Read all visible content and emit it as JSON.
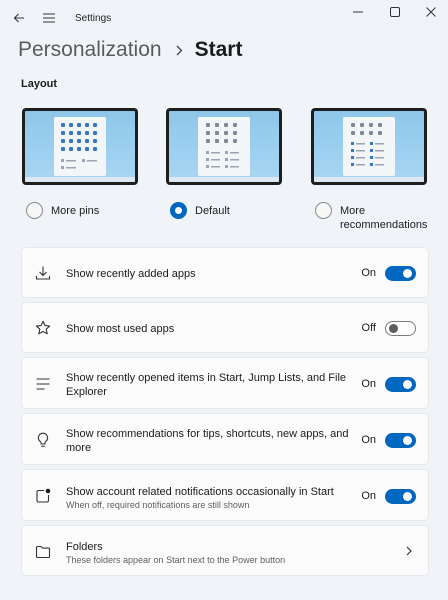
{
  "window": {
    "title": "Settings",
    "back_icon": "back-arrow-icon",
    "menu_icon": "hamburger-menu-icon",
    "controls": [
      "minimize-icon",
      "maximize-icon",
      "close-icon"
    ]
  },
  "breadcrumb": {
    "parent": "Personalization",
    "separator_icon": "chevron-right-icon",
    "current": "Start"
  },
  "layout": {
    "heading": "Layout",
    "options": [
      {
        "label": "More pins",
        "selected": false
      },
      {
        "label": "Default",
        "selected": true
      },
      {
        "label": "More recommendations",
        "selected": false
      }
    ]
  },
  "settings": [
    {
      "icon": "download-icon",
      "label": "Show recently added apps",
      "state": "On",
      "toggle_on": true
    },
    {
      "icon": "star-icon",
      "label": "Show most used apps",
      "state": "Off",
      "toggle_on": false
    },
    {
      "icon": "list-lines-icon",
      "label": "Show recently opened items in Start, Jump Lists, and File Explorer",
      "state": "On",
      "toggle_on": true
    },
    {
      "icon": "lightbulb-icon",
      "label": "Show recommendations for tips, shortcuts, new apps, and more",
      "state": "On",
      "toggle_on": true
    },
    {
      "icon": "notification-badge-icon",
      "label": "Show account related notifications occasionally in Start",
      "sublabel": "When off, required notifications are still shown",
      "state": "On",
      "toggle_on": true
    }
  ],
  "folders": {
    "icon": "folder-icon",
    "label": "Folders",
    "sublabel": "These folders appear on Start next to the Power button",
    "chevron_icon": "chevron-right-icon"
  },
  "colors": {
    "accent": "#0067c0",
    "background": "#f0f4f9",
    "card": "#fbfbfb",
    "preview_wallpaper": "#a9d6f2",
    "pin_blue": "#3a78c4"
  }
}
